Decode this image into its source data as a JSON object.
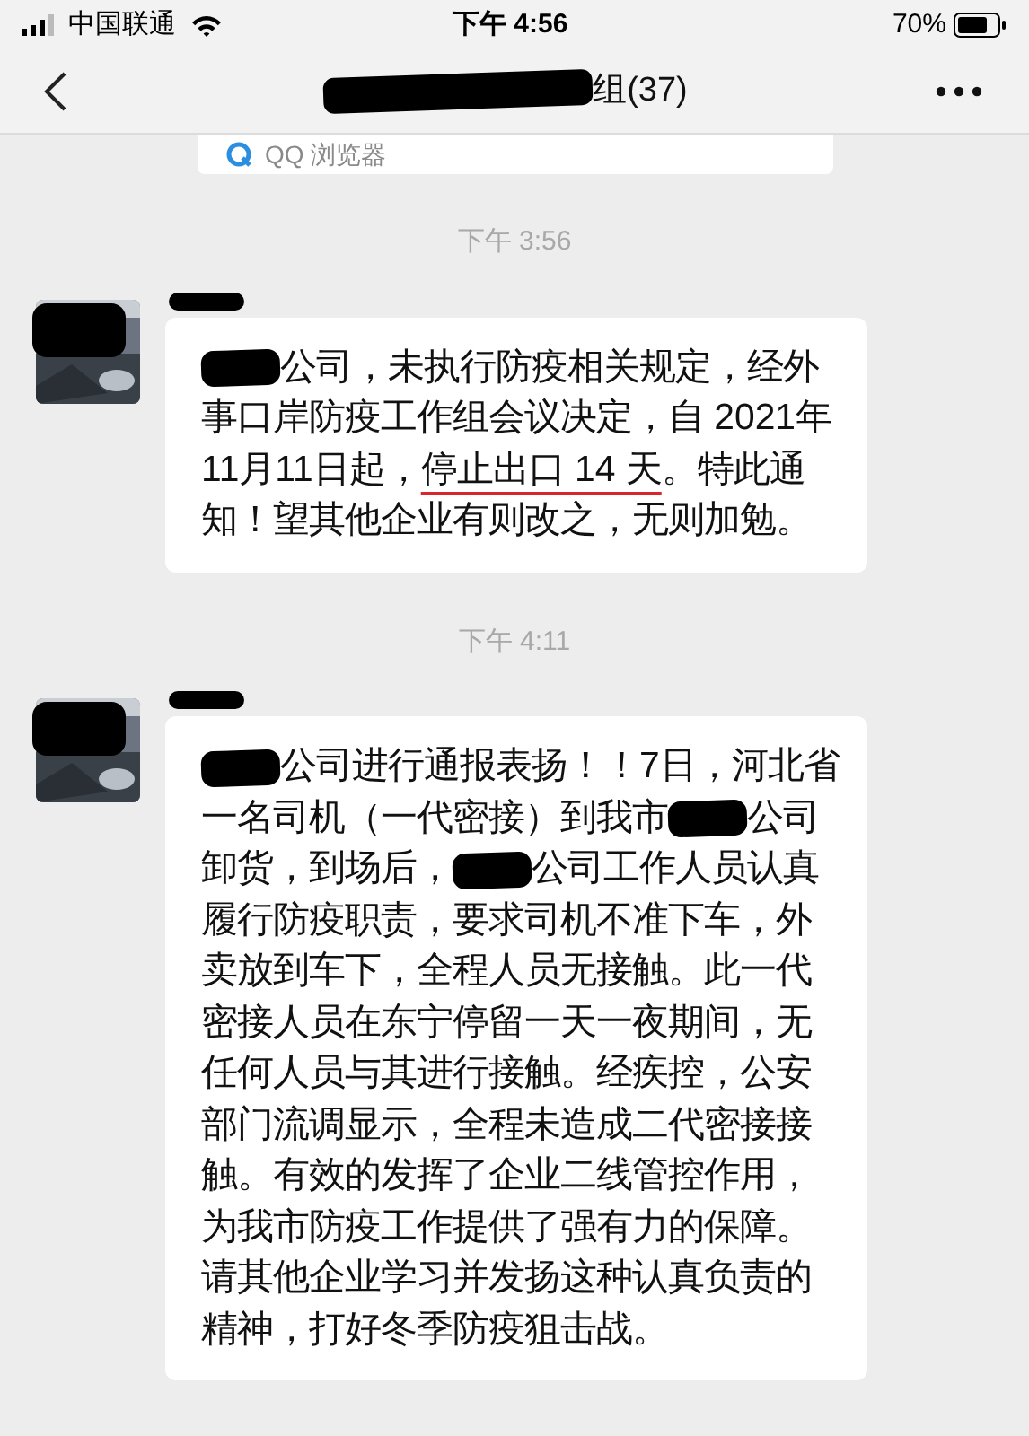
{
  "status_bar": {
    "carrier": "中国联通",
    "time": "下午 4:56",
    "battery": "70%"
  },
  "nav_bar": {
    "title_parts": [
      {
        "kind": "redaction"
      },
      {
        "kind": "text",
        "text": "组(37)"
      }
    ]
  },
  "browser_hint": {
    "text": "QQ 浏览器"
  },
  "messages": [
    {
      "timestamp": "下午 3:56",
      "parts": [
        {
          "kind": "redaction"
        },
        {
          "kind": "text",
          "text": "公司，未执行防疫相关规定，经外事口岸防疫工作组会议决定，自 2021年11月11日起，"
        },
        {
          "kind": "underlined",
          "text": "停止出口 14 天"
        },
        {
          "kind": "text",
          "text": "。特此通知！望其他企业有则改之，无则加勉。"
        }
      ]
    },
    {
      "timestamp": "下午 4:11",
      "parts": [
        {
          "kind": "redaction"
        },
        {
          "kind": "text",
          "text": "公司进行通报表扬！！7日，河北省一名司机（一代密接）到我市"
        },
        {
          "kind": "redaction"
        },
        {
          "kind": "text",
          "text": "公司卸货，到场后，"
        },
        {
          "kind": "redaction"
        },
        {
          "kind": "text",
          "text": "公司工作人员认真履行防疫职责，要求司机不准下车，外卖放到车下，全程人员无接触。此一代密接人员在东宁停留一天一夜期间，无任何人员与其进行接触。经疾控，公安部门流调显示，全程未造成二代密接接触。有效的发挥了企业二线管控作用，为我市防疫工作提供了强有力的保障。请其他企业学习并发扬这种认真负责的精神，打好冬季防疫狙击战。"
        }
      ]
    }
  ]
}
